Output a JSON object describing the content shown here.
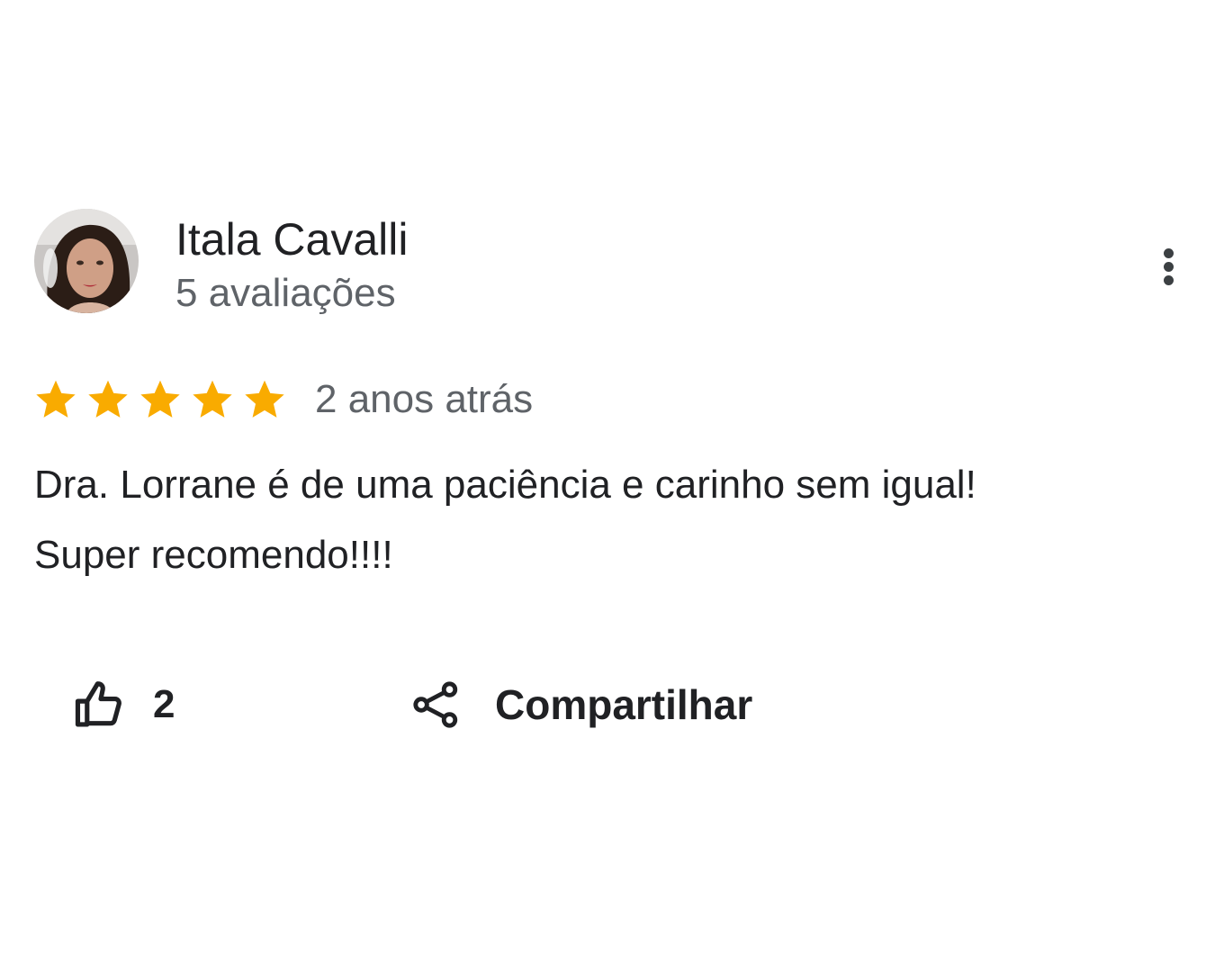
{
  "review": {
    "author": {
      "name": "Itala Cavalli",
      "meta": "5 avaliações"
    },
    "rating": {
      "stars": 5,
      "max": 5,
      "color": "#f9ab00"
    },
    "date": "2 anos atrás",
    "text": {
      "line1": "Dra. Lorrane é de uma paciência e carinho sem igual!",
      "line2": "Super recomendo!!!!"
    },
    "actions": {
      "like_count": "2",
      "share_label": "Compartilhar"
    },
    "icons": {
      "menu": "more-vert-icon",
      "like": "thumb-up-icon",
      "share": "share-icon"
    }
  }
}
